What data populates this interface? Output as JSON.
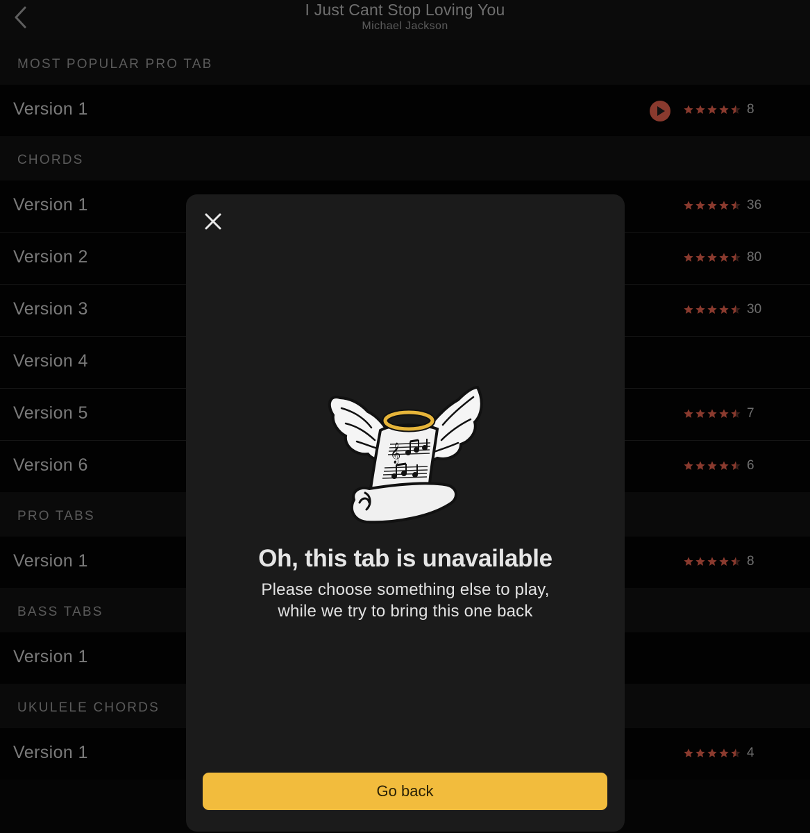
{
  "header": {
    "title": "I Just Cant Stop Loving You",
    "artist": "Michael Jackson",
    "back_icon": "chevron-left-icon"
  },
  "colors": {
    "accent_button": "#f2bc3d",
    "star_color": "#8a3a2e",
    "play_icon": "#8a3a2e",
    "modal_bg": "#1b1b1b"
  },
  "sections": [
    {
      "title": "MOST POPULAR PRO TAB",
      "rows": [
        {
          "label": "Version 1",
          "rating": 4.5,
          "count": "8",
          "has_play": true
        }
      ]
    },
    {
      "title": "CHORDS",
      "rows": [
        {
          "label": "Version 1",
          "rating": 4.5,
          "count": "36"
        },
        {
          "label": "Version 2",
          "rating": 4.5,
          "count": "80"
        },
        {
          "label": "Version 3",
          "rating": 4.5,
          "count": "30"
        },
        {
          "label": "Version 4"
        },
        {
          "label": "Version 5",
          "rating": 4.5,
          "count": "7"
        },
        {
          "label": "Version 6",
          "rating": 4.5,
          "count": "6"
        }
      ]
    },
    {
      "title": "PRO TABS",
      "rows": [
        {
          "label": "Version 1",
          "rating": 4.5,
          "count": "8"
        }
      ]
    },
    {
      "title": "BASS TABS",
      "rows": [
        {
          "label": "Version 1"
        }
      ]
    },
    {
      "title": "UKULELE CHORDS",
      "rows": [
        {
          "label": "Version 1",
          "rating": 4.5,
          "count": "4"
        }
      ]
    }
  ],
  "modal": {
    "close_icon": "close-icon",
    "illustration": "angel-sheet-music-illustration",
    "title": "Oh, this tab is unavailable",
    "message_line1": "Please choose something else to play,",
    "message_line2": "while we try to bring this one back",
    "button_label": "Go back"
  }
}
